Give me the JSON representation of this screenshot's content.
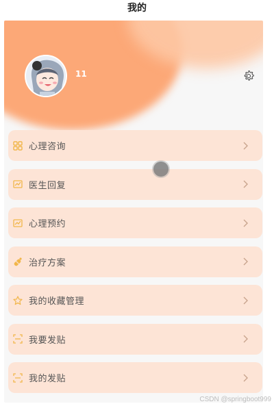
{
  "header": {
    "title": "我的"
  },
  "profile": {
    "username": "11"
  },
  "menu": {
    "items": [
      {
        "label": "心理咨询",
        "icon": "grid-icon"
      },
      {
        "label": "医生回复",
        "icon": "chart-icon"
      },
      {
        "label": "心理预约",
        "icon": "chart-icon"
      },
      {
        "label": "治疗方案",
        "icon": "pill-icon"
      },
      {
        "label": "我的收藏管理",
        "icon": "star-icon"
      },
      {
        "label": "我要发贴",
        "icon": "scan-icon"
      },
      {
        "label": "我的发贴",
        "icon": "scan-icon"
      }
    ]
  },
  "watermark": "CSDN @springboot999",
  "colors": {
    "accent": "#fca877",
    "item_bg": "#fde4d6",
    "icon": "#f1b64a"
  }
}
